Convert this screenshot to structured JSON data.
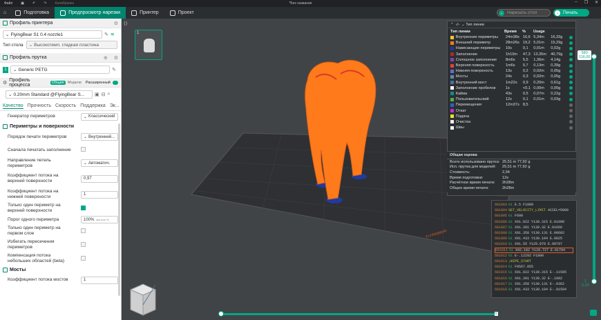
{
  "titlebar": {
    "file": "Файл",
    "calibration": "Калибровка",
    "title": "*Без названия",
    "minimize": "–",
    "maximize": "❐",
    "close": "✕"
  },
  "toolbar": {
    "tabs": [
      {
        "label": "Подготовка"
      },
      {
        "label": "Предпросмотр нарезки"
      },
      {
        "label": "Принтер"
      },
      {
        "label": "Проект"
      }
    ],
    "slice_label": "Нарезать стол",
    "print_label": "Печать"
  },
  "printer_profile": {
    "title": "Профиль принтера",
    "printer": "FlyingBear S1 0.4 nozzle1",
    "bed_label": "Тип стола",
    "bed_value": "Высокотемп. гладкая пластина"
  },
  "filament_profile": {
    "title": "Профиль прутка",
    "slot": "1",
    "filament": "Generic PETG"
  },
  "process_profile": {
    "title": "Профиль процесса",
    "toggle_general": "Общие",
    "toggle_models": "Модели",
    "advanced": "Расширенный",
    "profile": "0.20mm Standard @FlyingBear S..."
  },
  "quality_tabs": [
    "Качество",
    "Прочность",
    "Скорость",
    "Поддержка",
    "Эк..."
  ],
  "params": {
    "perimeter_gen_label": "Генератор периметров",
    "perimeter_gen_value": "Классический",
    "section_walls": "Периметры и поверхности",
    "print_order_label": "Порядок печати периметров",
    "print_order_value": "Внутренний...",
    "infill_first_label": "Сначала печатать заполнение",
    "loop_dir_label": "Направление петель периметров",
    "loop_dir_value": "Автоматич.",
    "top_flow_label": "Коэффициент потока на верхней поверхности",
    "top_flow_value": "0,97",
    "bottom_flow_label": "Коэффициент потока на нижней поверхности",
    "bottom_flow_value": "1",
    "one_wall_top_label": "Только один периметр на верхней поверхности",
    "one_wall_threshold_label": "Порог одного периметра",
    "one_wall_threshold_value": "100%",
    "one_wall_threshold_unit": "мм или %",
    "one_wall_first_label": "Только один периметр на первом слое",
    "avoid_crossing_label": "Избегать пересечения периметров",
    "small_flow_label": "Компенсация потока небольших областей (beta)",
    "section_bridges": "Мосты",
    "bridge_flow_label": "Коэффициент потока мостов",
    "bridge_flow_value": "1"
  },
  "plate": {
    "number": "1"
  },
  "legend": {
    "header": "Тип линии",
    "cols": [
      "Тип линии",
      "Время",
      "%",
      "Usage"
    ],
    "rows": [
      {
        "name": "Внутренние периметры",
        "time": "24m38s",
        "pct": "16,6",
        "len": "5,34m",
        "g": "16,33g",
        "color": "#f4c430"
      },
      {
        "name": "Внешний периметр",
        "time": "28m26s",
        "pct": "19,2",
        "len": "5,01m",
        "g": "15,29g",
        "color": "#ff7a1a"
      },
      {
        "name": "Нависающие периметры",
        "time": "10s",
        "pct": "0,1",
        "len": "0,01m",
        "g": "0,02g",
        "color": "#1f3aa0"
      },
      {
        "name": "Заполнение",
        "time": "1h10m",
        "pct": "47,3",
        "len": "13,35m",
        "g": "40,79g",
        "color": "#a0312f"
      },
      {
        "name": "Сплошное заполнение",
        "time": "8m6s",
        "pct": "5,5",
        "len": "1,36m",
        "g": "4,14g",
        "color": "#8c3fb0"
      },
      {
        "name": "Верхняя поверхность",
        "time": "1m6s",
        "pct": "0,7",
        "len": "0,13m",
        "g": "0,39g",
        "color": "#e0443a"
      },
      {
        "name": "Нижняя поверхность",
        "time": "13s",
        "pct": "0,2",
        "len": "0,02m",
        "g": "0,05g",
        "color": "#6a6ad0"
      },
      {
        "name": "Мосты",
        "time": "24s",
        "pct": "0,3",
        "len": "0,02m",
        "g": "0,05g",
        "color": "#5b8fa8"
      },
      {
        "name": "Внутренний мост",
        "time": "1m22s",
        "pct": "0,9",
        "len": "0,20m",
        "g": "0,61g",
        "color": "#4a6fa5"
      },
      {
        "name": "Заполнение пробелов",
        "time": "1s",
        "pct": "<0,1",
        "len": "0,00m",
        "g": "0,00g",
        "color": "#ffffff"
      },
      {
        "name": "Кайма",
        "time": "43s",
        "pct": "0,5",
        "len": "0,07m",
        "g": "0,22g",
        "color": "#1a8a8a"
      },
      {
        "name": "Пользовательский",
        "time": "12s",
        "pct": "0,1",
        "len": "0,01m",
        "g": "0,03g",
        "color": "#4fb04f"
      },
      {
        "name": "Перемещения",
        "time": "12m37s",
        "pct": "8,5",
        "len": "",
        "g": "",
        "color": "#2f5fd0"
      },
      {
        "name": "Откат",
        "time": "",
        "pct": "",
        "len": "",
        "g": "",
        "color": "#c030c0"
      },
      {
        "name": "Подача",
        "time": "",
        "pct": "",
        "len": "",
        "g": "",
        "color": "#e8e030"
      },
      {
        "name": "Очистка",
        "time": "",
        "pct": "",
        "len": "",
        "g": "",
        "color": "#f0f0f0"
      },
      {
        "name": "Швы",
        "time": "",
        "pct": "",
        "len": "",
        "g": "",
        "color": "#f5f5f5"
      }
    ]
  },
  "summary": {
    "title": "Общая оценка",
    "rows": [
      {
        "k": "Всего использовано прутка:",
        "v": "25,51 m   77,92 g"
      },
      {
        "k": "Исп. прутка для моделей:",
        "v": "25,51 m   77,92 g"
      },
      {
        "k": "Стоимость:",
        "v": "2,34"
      },
      {
        "k": "Время подготовки:",
        "v": "12s"
      },
      {
        "k": "Расчётное время печати:",
        "v": "2h28m"
      },
      {
        "k": "Общее время печати:",
        "v": "2h28m"
      }
    ]
  },
  "gcode": [
    {
      "n": "681803",
      "g": "G1",
      "rest": "E.5 F1800"
    },
    {
      "n": "681804",
      "g": "SET_VELOCITY_LIMIT",
      "rest": "ACCEL=5000"
    },
    {
      "n": "681805",
      "g": "G1",
      "rest": "F600"
    },
    {
      "n": "681806",
      "g": "G1",
      "rest": "X91.922 Y130.315 E.01998"
    },
    {
      "n": "681807",
      "g": "G1",
      "rest": "X91.391 Y130.32 E.01666"
    },
    {
      "n": "681808",
      "g": "G1",
      "rest": "X91.358 Y130.131 E.00602"
    },
    {
      "n": "681809",
      "g": "G1",
      "rest": "X91.433 Y130.104 E.0025"
    },
    {
      "n": "681810",
      "g": "G1",
      "rest": "X91.55 Y129.879 E.00797"
    },
    {
      "n": "681811",
      "g": "G1",
      "rest": "X92.102 Y129.727 E.01794"
    },
    {
      "n": "681812",
      "g": "G1",
      "rest": "E-.12292 F1800"
    },
    {
      "n": "681813",
      "g": ";WIPE_START",
      "rest": ""
    },
    {
      "n": "681814",
      "g": "G1",
      "rest": "F9567.055"
    },
    {
      "n": "681815",
      "g": "G1",
      "rest": "X91.922 Y130.315 E-.11595"
    },
    {
      "n": "681816",
      "g": "G1",
      "rest": "X91.391 Y130.32 E-.1002"
    },
    {
      "n": "681817",
      "g": "G1",
      "rest": "X91.358 Y130.131 E-.0362"
    },
    {
      "n": "681818",
      "g": "G1",
      "rest": "X91.433 Y130.104 E-.01504"
    }
  ],
  "vslider": {
    "top_layer": "580",
    "top_height": "116,00",
    "bottom_layer": "1",
    "bottom_height": "0,20"
  },
  "hslider": {
    "value": "6"
  },
  "bed_brand": "FLYINGBEAR"
}
